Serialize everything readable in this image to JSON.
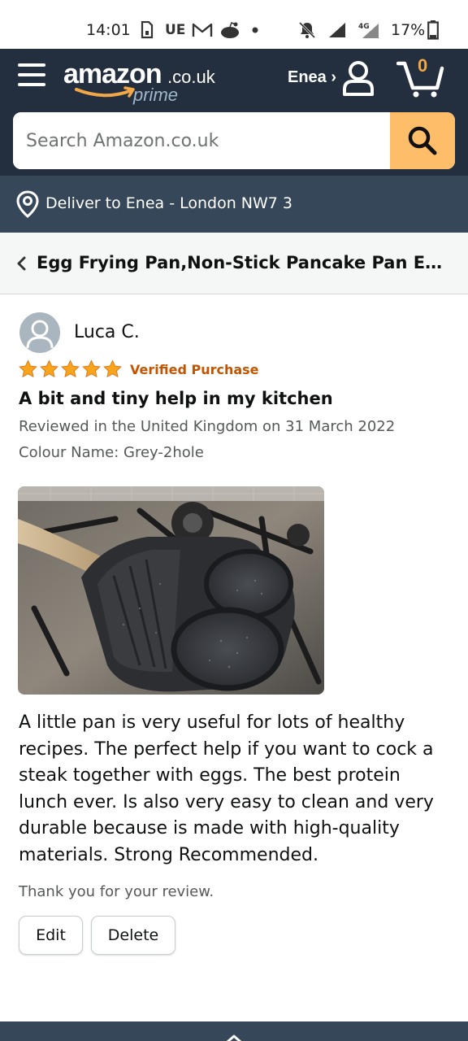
{
  "status_bar": {
    "time": "14:01",
    "icons": [
      "sim-card-icon",
      "ue-label",
      "gmail-icon",
      "reddit-icon",
      "dot-icon",
      "notifications-off-icon",
      "signal-icon",
      "network-4g-icon",
      "battery-icon"
    ],
    "carrier_label": "UE",
    "network_label": "4G",
    "battery": "17%"
  },
  "header": {
    "logo_text": "amazon",
    "logo_tld": ".co.uk",
    "logo_prime": "prime",
    "account_label": "Enea ›",
    "cart_count": "0",
    "search_placeholder": "Search Amazon.co.uk"
  },
  "deliver": {
    "text": "Deliver to Enea - London NW7 3"
  },
  "product": {
    "title": "Egg Frying Pan,Non-Stick Pancake Pan Eg..."
  },
  "review": {
    "reviewer": "Luca C.",
    "rating": 5,
    "rating_max": 5,
    "verified_label": "Verified Purchase",
    "title": "A bit and tiny help in my kitchen",
    "date_line": "Reviewed in the United Kingdom on 31 March 2022",
    "variant_line": "Colour Name: Grey-2hole",
    "body": "A little pan is very useful for lots of healthy recipes. The perfect help if you want to cock a steak together with eggs. The best protein lunch ever. Is also very easy to clean and very durable because is made with high-quality materials. Strong Recommended.",
    "thanks": "Thank you for your review.",
    "edit_label": "Edit",
    "delete_label": "Delete"
  },
  "colors": {
    "header_bg": "#232f3e",
    "deliver_bg": "#37475a",
    "search_button": "#febd69",
    "star": "#f7a51c",
    "verified": "#c45500"
  }
}
